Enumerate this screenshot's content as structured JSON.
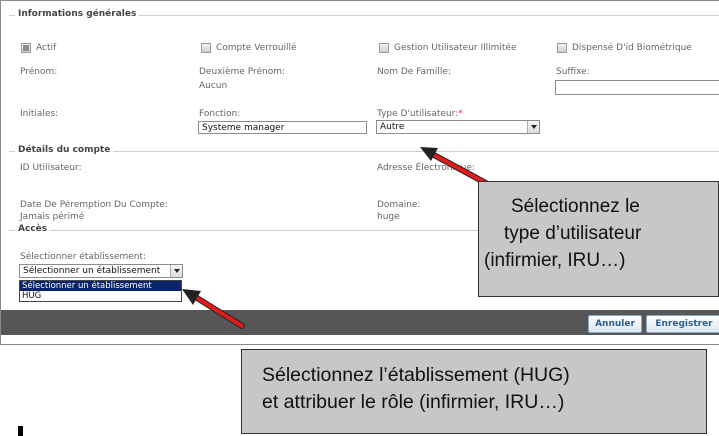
{
  "general": {
    "section_title": "Informations générales",
    "checkboxes": [
      {
        "label": "Actif",
        "checked": true
      },
      {
        "label": "Compte Verrouillé",
        "checked": false
      },
      {
        "label": "Gestion Utilisateur Illimitée",
        "checked": false
      },
      {
        "label": "Dispensé D'id Biométrique",
        "checked": false
      }
    ],
    "prenom_label": "Prénom:",
    "deuxieme_prenom_label": "Deuxième Prénom:",
    "deuxieme_prenom_value": "Aucun",
    "nom_label": "Nom De Famille:",
    "suffixe_label": "Suffixe:",
    "suffixe_value": "",
    "initiales_label": "Initiales:",
    "fonction_label": "Fonction:",
    "fonction_value": "Systeme manager",
    "type_label": "Type D'utilisateur:",
    "type_required_mark": "*",
    "type_value": "Autre"
  },
  "account": {
    "section_title": "Détails du compte",
    "id_label": "ID Utilisateur:",
    "email_label": "Adresse Électronique:",
    "expiry_label": "Date De Péremption Du Compte:",
    "expiry_value": "Jamais périmé",
    "domain_label": "Domaine:",
    "domain_value": "huge"
  },
  "access": {
    "section_title": "Accès",
    "establishment_label": "Sélectionner établissement:",
    "establishment_value": "Sélectionner un établissement",
    "options": [
      "Sélectionner un établissement",
      "HUG"
    ],
    "selected_option_index": 0
  },
  "footer": {
    "cancel_label": "Annuler",
    "save_label": "Enregistrer",
    "bar_color": "#565656"
  },
  "callouts": {
    "user_type": [
      "Sélectionnez le",
      "type d’utilisateur",
      "(infirmier, IRU…)"
    ],
    "establishment": [
      "Sélectionnez l’établissement (HUG)",
      "et attribuer le rôle (infirmier, IRU…)"
    ]
  },
  "colors": {
    "arrow": "#e31b1b",
    "callout_bg": "#c7c7c7",
    "button_text": "#2a5f92",
    "selected_option_bg": "#0a246a"
  }
}
